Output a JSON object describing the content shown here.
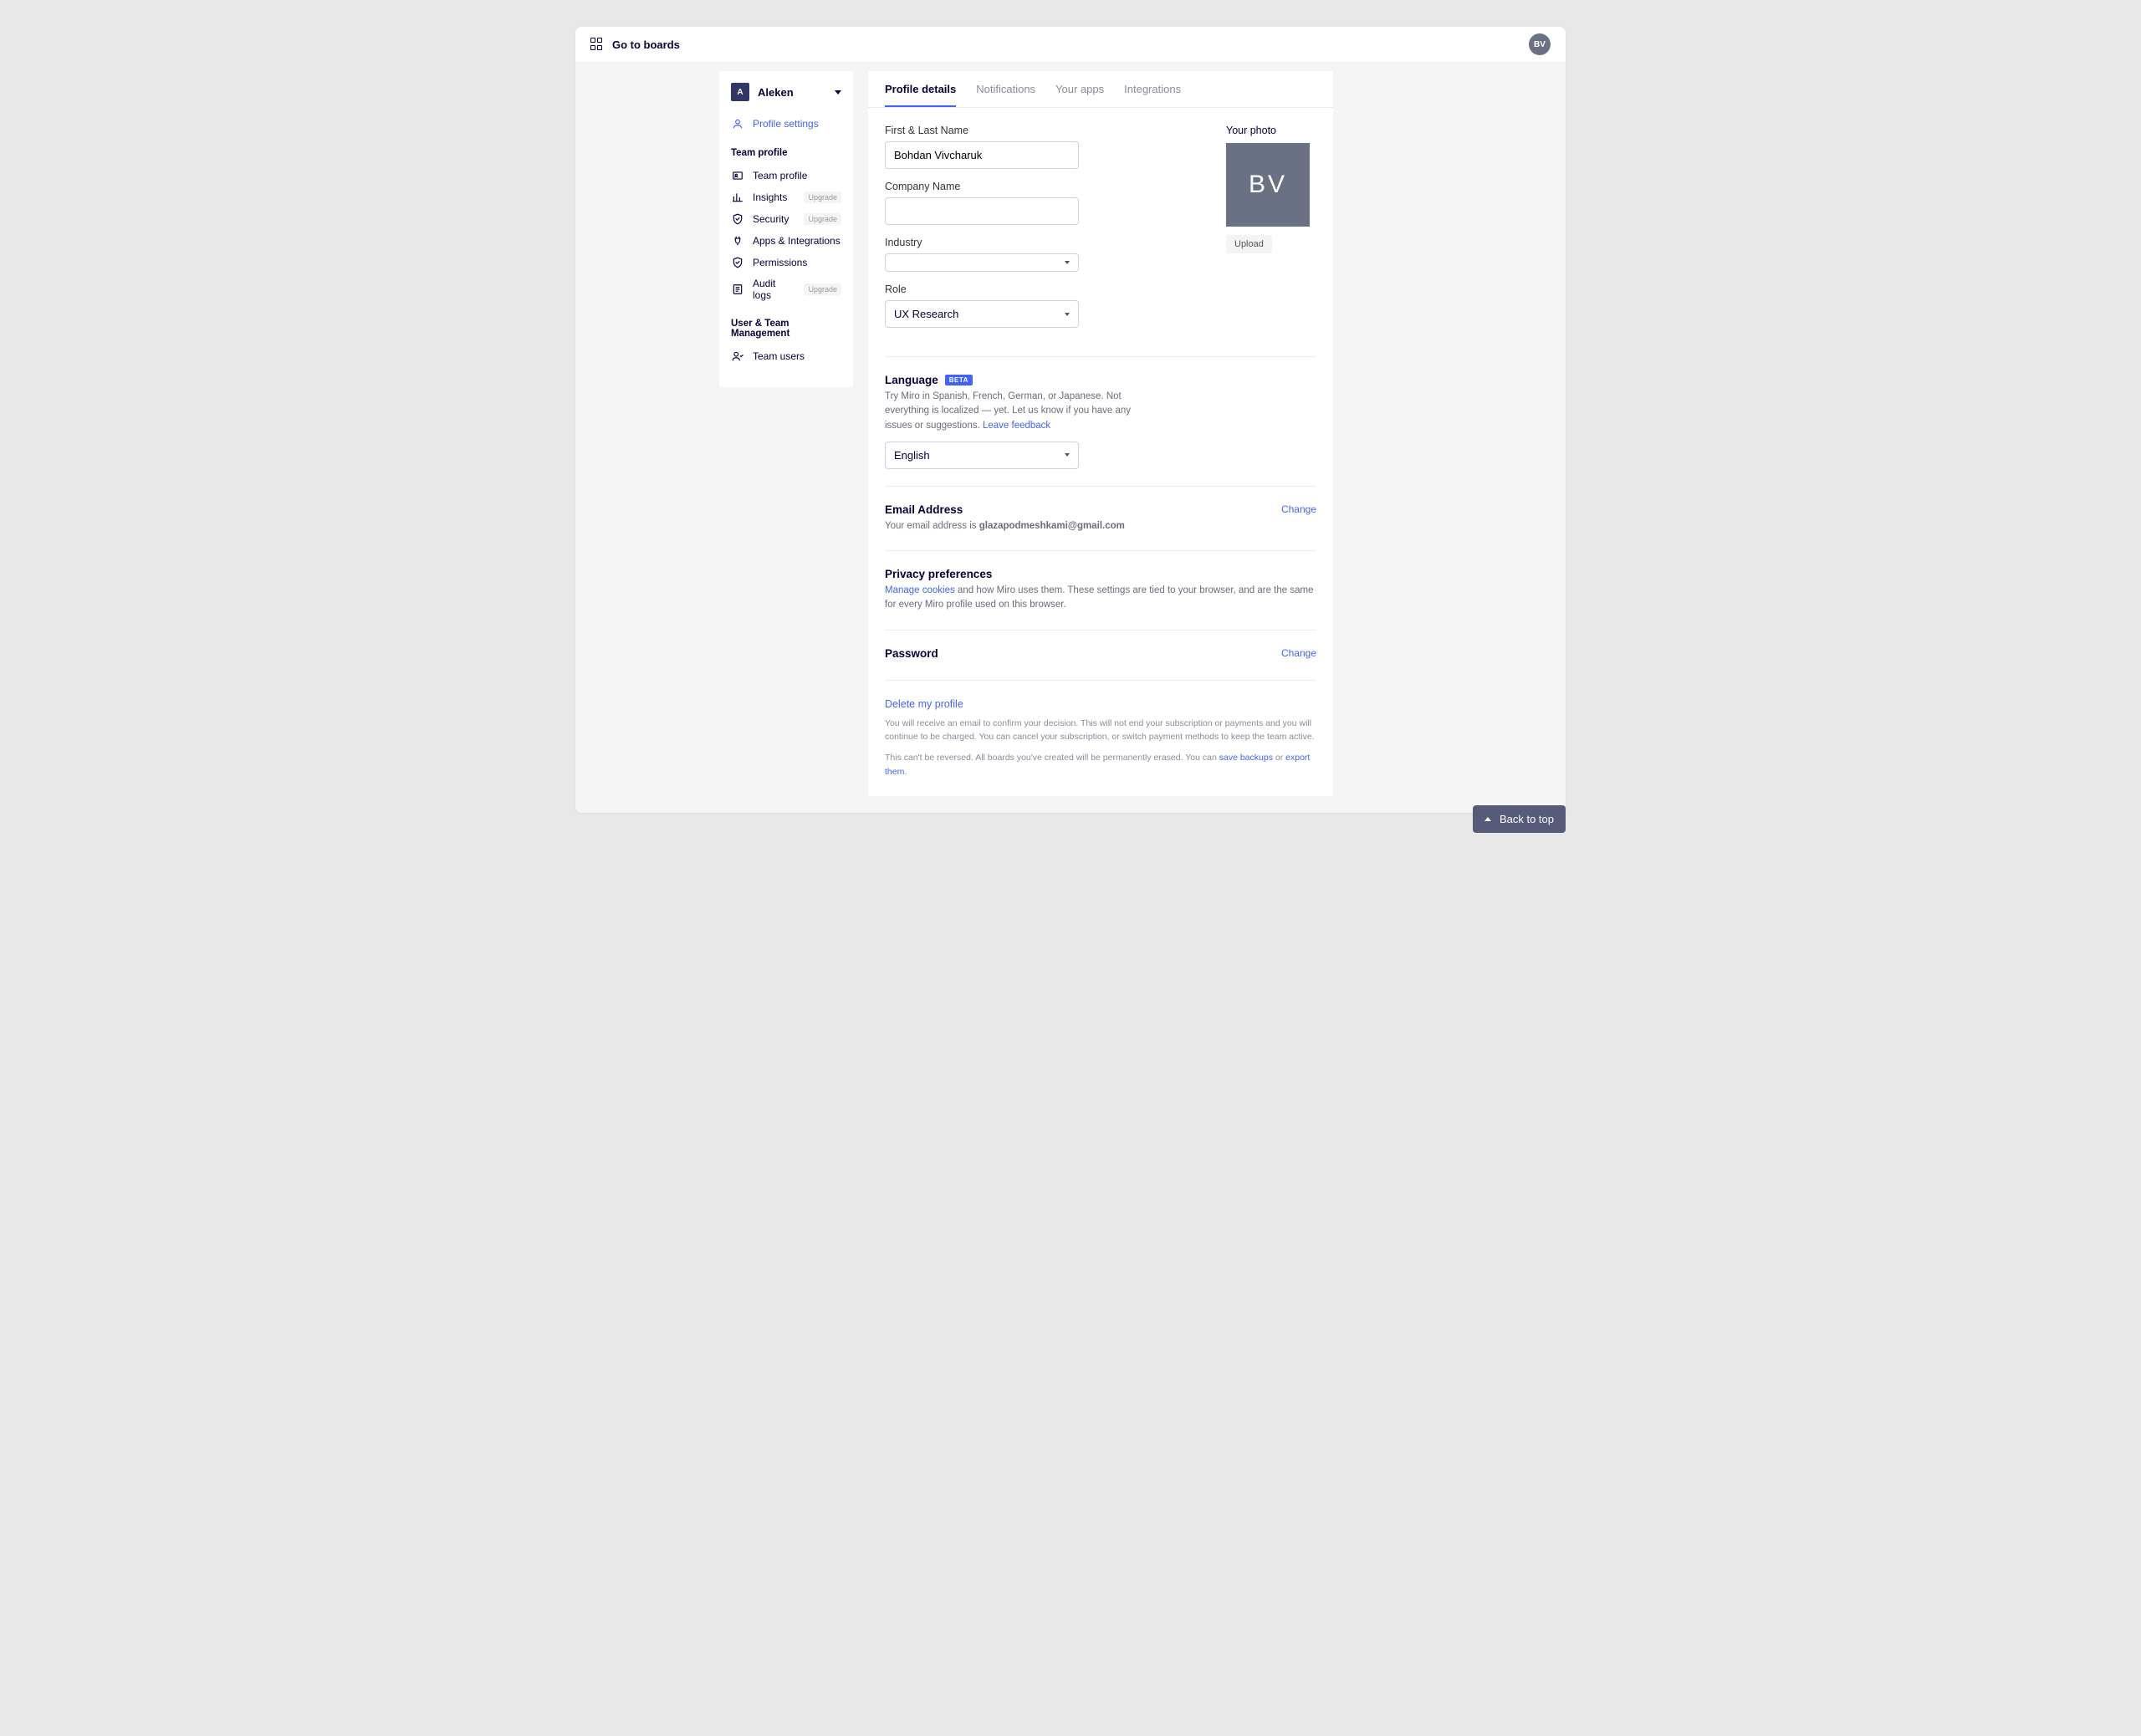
{
  "topbar": {
    "go_to_boards": "Go to boards",
    "avatar_initials": "BV"
  },
  "sidebar": {
    "team_badge": "A",
    "team_name": "Aleken",
    "profile_settings": "Profile settings",
    "heading_team": "Team profile",
    "items": [
      {
        "label": "Team profile",
        "upgrade": false
      },
      {
        "label": "Insights",
        "upgrade": true
      },
      {
        "label": "Security",
        "upgrade": true
      },
      {
        "label": "Apps & Integrations",
        "upgrade": false
      },
      {
        "label": "Permissions",
        "upgrade": false
      },
      {
        "label": "Audit logs",
        "upgrade": true
      }
    ],
    "upgrade_label": "Upgrade",
    "heading_users": "User & Team Management",
    "team_users": "Team users"
  },
  "tabs": {
    "profile_details": "Profile details",
    "notifications": "Notifications",
    "your_apps": "Your apps",
    "integrations": "Integrations"
  },
  "form": {
    "name_label": "First & Last Name",
    "name_value": "Bohdan Vivcharuk",
    "company_label": "Company Name",
    "company_value": "",
    "industry_label": "Industry",
    "industry_value": "",
    "role_label": "Role",
    "role_value": "UX Research"
  },
  "photo": {
    "label": "Your photo",
    "initials": "BV",
    "upload": "Upload"
  },
  "language": {
    "heading": "Language",
    "beta": "BETA",
    "text": "Try Miro in Spanish, French, German, or Japanese. Not everything is localized — yet. Let us know if you have any issues or suggestions. ",
    "leave_feedback": "Leave feedback",
    "value": "English"
  },
  "email": {
    "heading": "Email Address",
    "prefix": "Your email address is ",
    "address": "glazapodmeshkami@gmail.com",
    "change": "Change"
  },
  "privacy": {
    "heading": "Privacy preferences",
    "manage_cookies": "Manage cookies",
    "text": " and how Miro uses them. These settings are tied to your browser, and are the same for every Miro profile used on this browser."
  },
  "password": {
    "heading": "Password",
    "change": "Change"
  },
  "delete": {
    "link": "Delete my profile",
    "text1": "You will receive an email to confirm your decision. This will not end your subscription or payments and you will continue to be charged. You can cancel your subscription, or switch payment methods to keep the team active.",
    "text2_a": "This can't be reversed. All boards you've created will be permanently erased. You can ",
    "save_backups": "save backups",
    "or": " or ",
    "export_them": "export them",
    "period": "."
  },
  "back_to_top": "Back to top"
}
